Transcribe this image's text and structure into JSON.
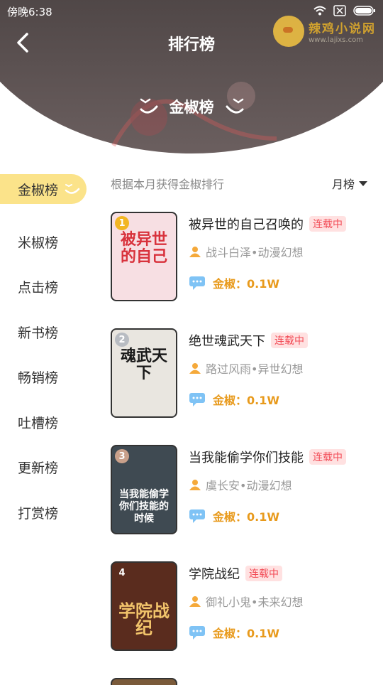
{
  "status_bar": {
    "time": "傍晚6:38"
  },
  "watermark": {
    "title": "辣鸡小说网",
    "url": "www.lajixs.com"
  },
  "header": {
    "title": "排行榜",
    "ranking_name": "金椒榜"
  },
  "sidebar": {
    "items": [
      {
        "label": "金椒榜",
        "active": true
      },
      {
        "label": "米椒榜"
      },
      {
        "label": "点击榜"
      },
      {
        "label": "新书榜"
      },
      {
        "label": "畅销榜"
      },
      {
        "label": "吐槽榜"
      },
      {
        "label": "更新榜"
      },
      {
        "label": "打赏榜"
      }
    ]
  },
  "list": {
    "description": "根据本月获得金椒排行",
    "period": "月榜",
    "books": [
      {
        "rank": "1",
        "title": "被异世的自己召唤的",
        "status": "连载中",
        "author_category": "战斗白泽•动漫幻想",
        "heat_label": "金椒：",
        "heat_value": "0.1W",
        "cover_text": "被异世的自己",
        "cover_color": "#f7dfe3",
        "cover_text_color": "#d8323c"
      },
      {
        "rank": "2",
        "title": "绝世魂武天下",
        "status": "连载中",
        "author_category": "路过风雨•异世幻想",
        "heat_label": "金椒：",
        "heat_value": "0.1W",
        "cover_text": "魂武天下",
        "cover_color": "#e9e6e0",
        "cover_text_color": "#1a1a1a"
      },
      {
        "rank": "3",
        "title": "当我能偷学你们技能",
        "status": "连载中",
        "author_category": "虞长安•动漫幻想",
        "heat_label": "金椒：",
        "heat_value": "0.1W",
        "cover_text": "当我能偷学你们技能的时候",
        "cover_color": "#3f4a52",
        "cover_text_color": "#ffffff"
      },
      {
        "rank": "4",
        "title": "学院战纪",
        "status": "连载中",
        "author_category": "御礼小鬼•未来幻想",
        "heat_label": "金椒：",
        "heat_value": "0.1W",
        "cover_text": "学院战纪",
        "cover_color": "#5a2c1e",
        "cover_text_color": "#f2c46b"
      }
    ]
  },
  "colors": {
    "accent_yellow": "#fbe38a",
    "tag_red": "#f24a55",
    "heat_orange": "#e89a1c"
  }
}
